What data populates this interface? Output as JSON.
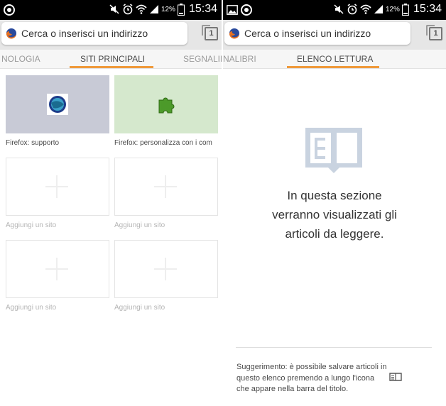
{
  "left": {
    "status": {
      "battery_pct": "12%",
      "time": "15:34"
    },
    "url_placeholder": "Cerca o inserisci un indirizzo",
    "tab_count": "1",
    "tabs": [
      {
        "label": "NOLOGIA"
      },
      {
        "label": "SITI PRINCIPALI"
      },
      {
        "label": "SEGNALIB"
      }
    ],
    "active_tab": "SITI PRINCIPALI",
    "tiles": [
      {
        "label": "Firefox: supporto"
      },
      {
        "label": "Firefox: personalizza con i com"
      },
      {
        "label": "Aggiungi un sito"
      },
      {
        "label": "Aggiungi un sito"
      },
      {
        "label": "Aggiungi un sito"
      },
      {
        "label": "Aggiungi un sito"
      }
    ]
  },
  "right": {
    "status": {
      "battery_pct": "12%",
      "time": "15:34"
    },
    "url_placeholder": "Cerca o inserisci un indirizzo",
    "tab_count": "1",
    "tabs": [
      {
        "label": "NALIBRI"
      },
      {
        "label": "ELENCO LETTURA"
      }
    ],
    "active_tab": "ELENCO LETTURA",
    "empty_message_lines": [
      "In questa sezione",
      "verranno visualizzati gli",
      "articoli da leggere."
    ],
    "hint_lines": [
      "Suggerimento: è possibile salvare articoli in",
      "questo elenco premendo a lungo l'icona",
      "che appare nella barra del titolo."
    ]
  },
  "colors": {
    "accent": "#ef9a3c",
    "status_bar": "#000000",
    "toolbar": "#e6e6e6",
    "tile_support": "#c8cad6",
    "tile_addon": "#d5e8cd",
    "reader_icon": "#c9d3e0"
  }
}
